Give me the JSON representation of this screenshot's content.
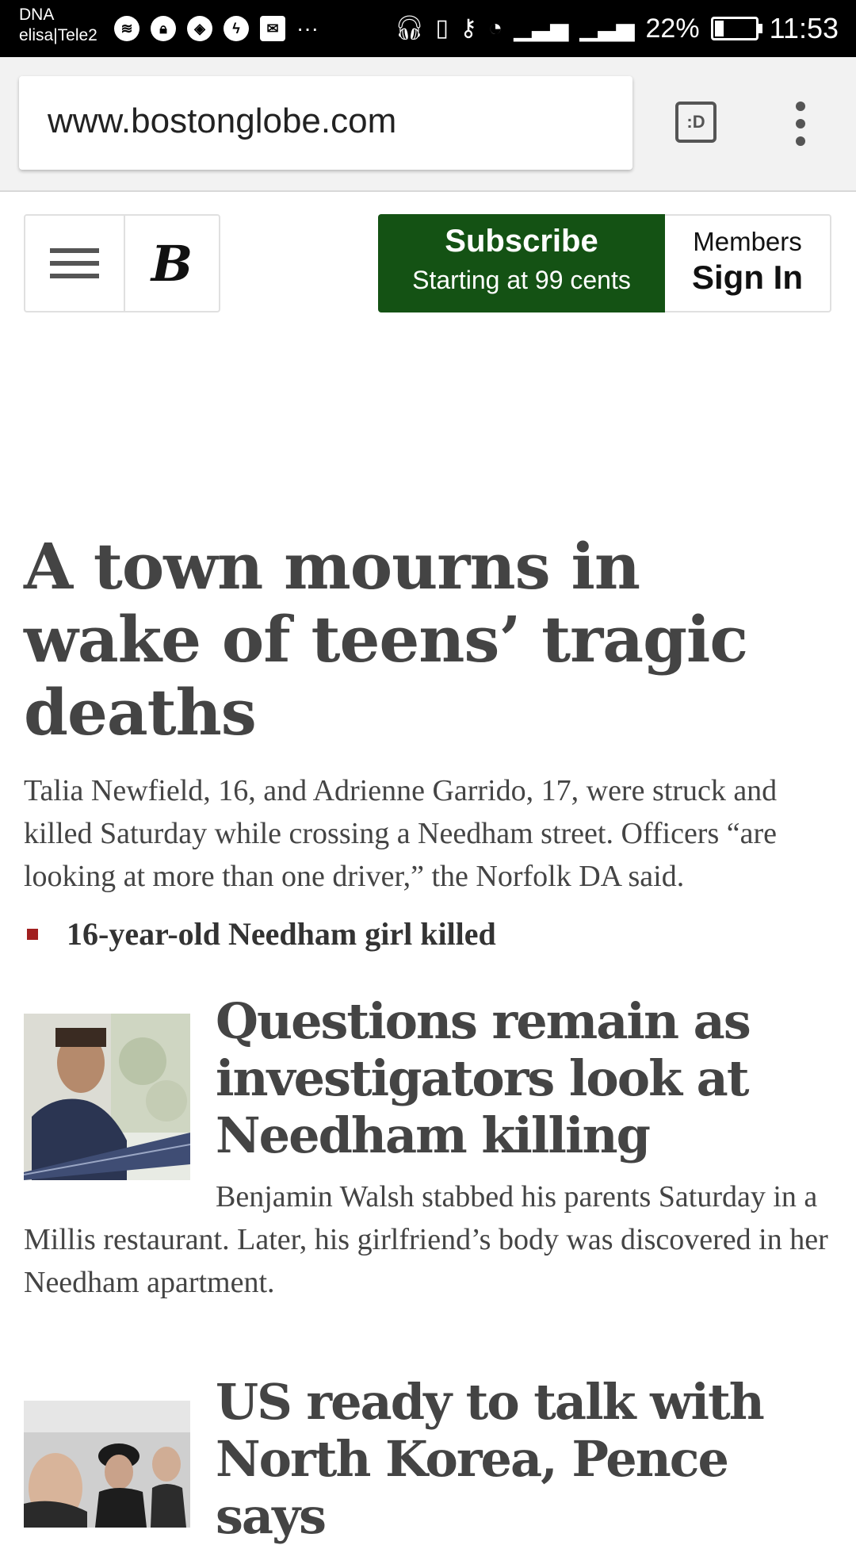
{
  "status_bar": {
    "carrier_primary": "DNA",
    "carrier_secondary": "elisa|Tele2",
    "notification_icons": [
      "spotify-icon",
      "lock-icon",
      "shield-icon",
      "messenger-icon",
      "mail-icon"
    ],
    "more": "···",
    "battery_percent": "22%",
    "battery_level": 0.22,
    "time": "11:53"
  },
  "browser": {
    "url": "www.bostonglobe.com",
    "tabs_label": ":D"
  },
  "site_header": {
    "logo": "B",
    "subscribe_title": "Subscribe",
    "subscribe_subtitle": "Starting at 99 cents",
    "members_label": "Members",
    "sign_in_label": "Sign In",
    "subscribe_color": "#145214"
  },
  "lead_story": {
    "headline": "A town mourns in wake of teens’ tragic deaths",
    "summary": "Talia Newfield, 16, and Adrienne Garrido, 17, were struck and killed Saturday while crossing a Needham street. Officers “are looking at more than one driver,” the Norfolk DA said.",
    "related_link": "16-year-old Needham girl killed",
    "bullet_color": "#a11f1f"
  },
  "stories": [
    {
      "headline": "Questions remain as investigators look at Needham killing",
      "summary": "Benjamin Walsh stabbed his parents Saturday in a Millis restaurant. Later, his girlfriend’s body was discovered in her Needham apartment."
    },
    {
      "headline": "US ready to talk with North Korea, Pence says",
      "summary": ""
    }
  ]
}
